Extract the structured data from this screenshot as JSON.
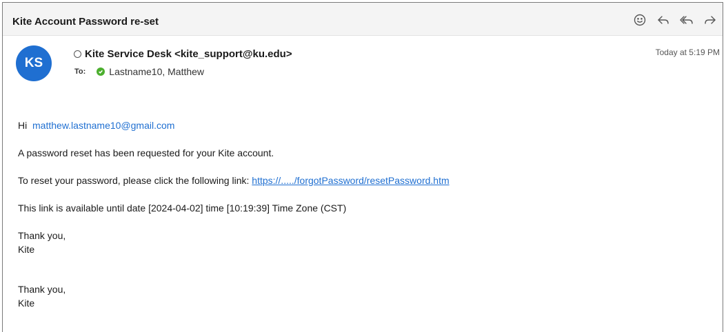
{
  "email": {
    "subject": "Kite Account Password re-set",
    "avatar_initials": "KS",
    "sender": "Kite Service Desk <kite_support@ku.edu>",
    "to_label": "To:",
    "recipient": "Lastname10, Matthew",
    "timestamp": "Today at 5:19 PM",
    "actions": [
      {
        "icon": "smiley-icon"
      },
      {
        "icon": "reply-icon"
      },
      {
        "icon": "reply-all-icon"
      },
      {
        "icon": "forward-icon"
      }
    ]
  },
  "body": {
    "greeting": "Hi",
    "greeting_email": "matthew.lastname10@gmail.com",
    "line1": "A password reset has been requested for your Kite account.",
    "line2_prefix": "To reset your password, please click the following link:",
    "reset_link": "https://...../forgotPassword/resetPassword.htm",
    "line3": "This link is available until date [2024-04-02] time [10:19:39] Time Zone (CST)",
    "signoff1": "Thank you,",
    "signature1": "Kite",
    "signoff2": "Thank you,",
    "signature2": "Kite"
  },
  "colors": {
    "avatar": "#1f6fd1",
    "link": "#1f6fd1",
    "presence": "#4caf2e"
  }
}
